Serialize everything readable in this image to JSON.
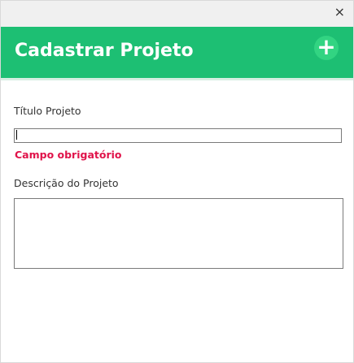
{
  "window": {
    "close_label": "×"
  },
  "header": {
    "title": "Cadastrar Projeto",
    "add_label": "+"
  },
  "form": {
    "title_label": "Título Projeto",
    "title_value": "",
    "title_error": "Campo obrigatório",
    "description_label": "Descrição do Projeto",
    "description_value": ""
  },
  "colors": {
    "header_bg": "#1dbf73",
    "error": "#e0134a"
  }
}
